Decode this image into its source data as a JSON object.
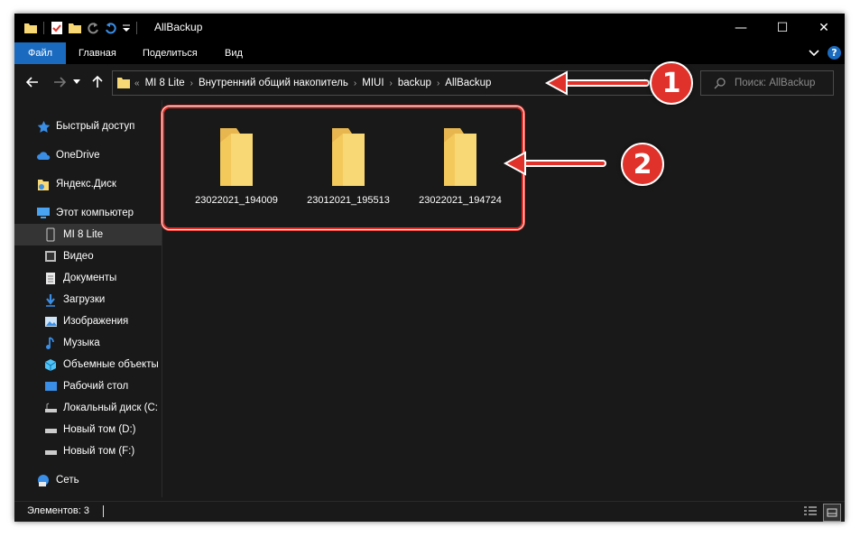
{
  "window": {
    "title": "AllBackup",
    "controls": {
      "minimize": "—",
      "maximize": "☐",
      "close": "✕"
    }
  },
  "ribbon": {
    "tabs": [
      "Файл",
      "Главная",
      "Поделиться",
      "Вид"
    ]
  },
  "address": {
    "overflow": "«",
    "crumbs": [
      "MI 8 Lite",
      "Внутренний общий накопитель",
      "MIUI",
      "backup",
      "AllBackup"
    ],
    "separator": "›"
  },
  "search": {
    "placeholder": "Поиск: AllBackup"
  },
  "sidebar": {
    "items": [
      {
        "label": "Быстрый доступ",
        "icon": "star-icon"
      },
      {
        "label": "OneDrive",
        "icon": "cloud-icon"
      },
      {
        "label": "Яндекс.Диск",
        "icon": "yandex-disk-icon"
      },
      {
        "label": "Этот компьютер",
        "icon": "computer-icon"
      },
      {
        "label": "MI 8 Lite",
        "icon": "phone-icon"
      },
      {
        "label": "Видео",
        "icon": "video-icon"
      },
      {
        "label": "Документы",
        "icon": "documents-icon"
      },
      {
        "label": "Загрузки",
        "icon": "downloads-icon"
      },
      {
        "label": "Изображения",
        "icon": "pictures-icon"
      },
      {
        "label": "Музыка",
        "icon": "music-icon"
      },
      {
        "label": "Объемные объекты",
        "icon": "3d-objects-icon"
      },
      {
        "label": "Рабочий стол",
        "icon": "desktop-icon"
      },
      {
        "label": "Локальный диск (C:",
        "icon": "drive-icon"
      },
      {
        "label": "Новый том (D:)",
        "icon": "drive-icon"
      },
      {
        "label": "Новый том (F:)",
        "icon": "drive-icon"
      },
      {
        "label": "Сеть",
        "icon": "network-icon"
      }
    ]
  },
  "folders": [
    "23022021_194009",
    "23012021_195513",
    "23022021_194724"
  ],
  "status": {
    "text": "Элементов: 3"
  },
  "annotations": {
    "badge1": "1",
    "badge2": "2",
    "color": "#e0322a"
  },
  "colors": {
    "accent": "#1a6bc0",
    "folder": "#f8d775",
    "background": "#191919"
  }
}
